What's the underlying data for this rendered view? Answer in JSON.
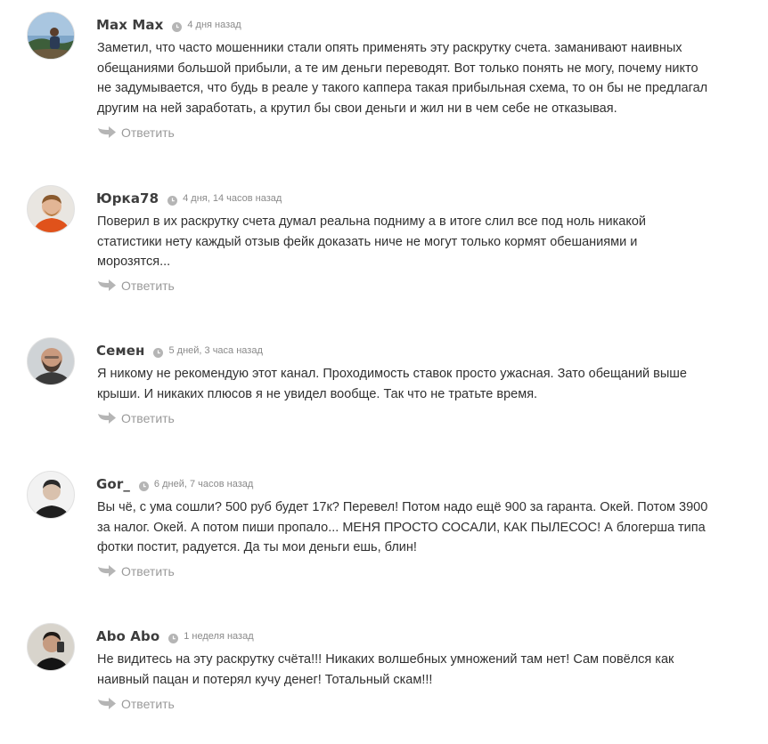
{
  "comments": [
    {
      "author": "Max Max",
      "date": "4 дня назад",
      "text": "Заметил, что часто мошенники стали опять применять эту раскрутку счета. заманивают наивных обещаниями большой прибыли, а те им деньги переводят. Вот только понять не могу, почему никто не задумывается, что будь в реале у такого каппера такая прибыльная схема, то он бы не предлагал другим на ней заработать, а крутил бы свои деньги и жил ни в чем себе не отказывая.",
      "reply_label": "Ответить"
    },
    {
      "author": "Юрка78",
      "date": "4 дня, 14 часов назад",
      "text": "Поверил в их раскрутку счета думал реальна подниму а в итоге слил все под ноль никакой статистики нету каждый отзыв фейк доказать ниче не могут только кормят обешаниями и морозятся...",
      "reply_label": "Ответить"
    },
    {
      "author": "Семен",
      "date": "5 дней, 3 часа назад",
      "text": "Я никому не рекомендую этот канал. Проходимость ставок просто ужасная. Зато обещаний выше крыши. И никаких плюсов я не увидел вообще. Так что не тратьте время.",
      "reply_label": "Ответить"
    },
    {
      "author": "Gor_",
      "date": "6 дней, 7 часов назад",
      "text": "Вы чё, с ума сошли? 500 руб будет 17к? Перевел! Потом надо ещё 900 за гаранта. Окей. Потом 3900 за налог. Окей. А потом пиши пропало... МЕНЯ ПРОСТО СОСАЛИ, КАК ПЫЛЕСОС! А блогерша типа фотки постит, радуется. Да ты мои деньги ешь, блин!",
      "reply_label": "Ответить"
    },
    {
      "author": "Abo Abo",
      "date": "1 неделя назад",
      "text": "Не видитесь на эту раскрутку счёта!!! Никаких волшебных умножений там нет! Сам повёлся как наивный пацан и потерял кучу денег! Тотальный скам!!!",
      "reply_label": "Ответить"
    }
  ],
  "icons": {
    "clock": "clock-icon",
    "reply": "reply-arrow-icon"
  },
  "colors": {
    "author": "#3d3d3d",
    "text": "#303030",
    "muted": "#8a8a8a",
    "reply": "#9a9a9a",
    "icon": "#b5b5b5"
  }
}
